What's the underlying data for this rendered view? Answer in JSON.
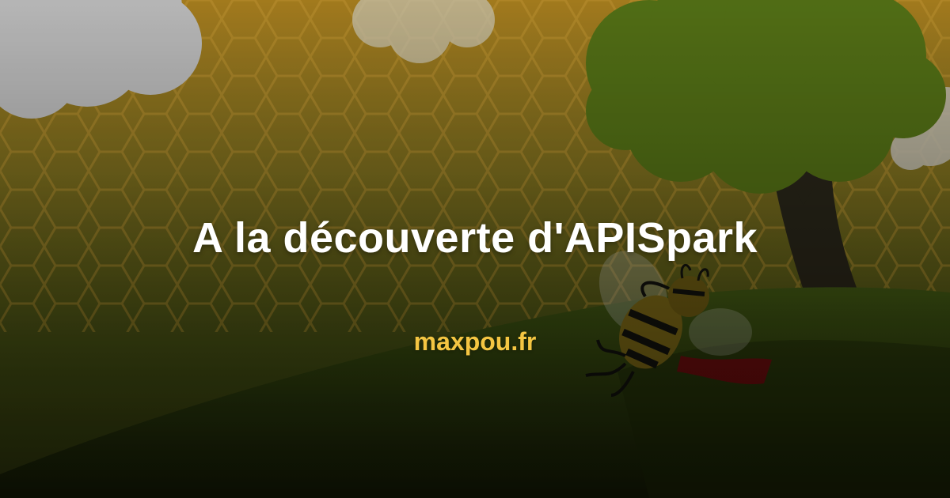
{
  "title": "A la découverte d'APISpark",
  "site": "maxpou.fr",
  "colors": {
    "title": "#ffffff",
    "site": "#f4c542",
    "honeycomb": "#c89a2a",
    "grass": "#3f5a12",
    "foliage": "#5c7c18",
    "trunk": "#2e2a1c",
    "cloud": "#d6d6d6"
  },
  "illustration": {
    "background": "honeycomb-pattern",
    "elements": [
      "cloud",
      "tree",
      "grass-hill",
      "sleeping-bee"
    ]
  }
}
